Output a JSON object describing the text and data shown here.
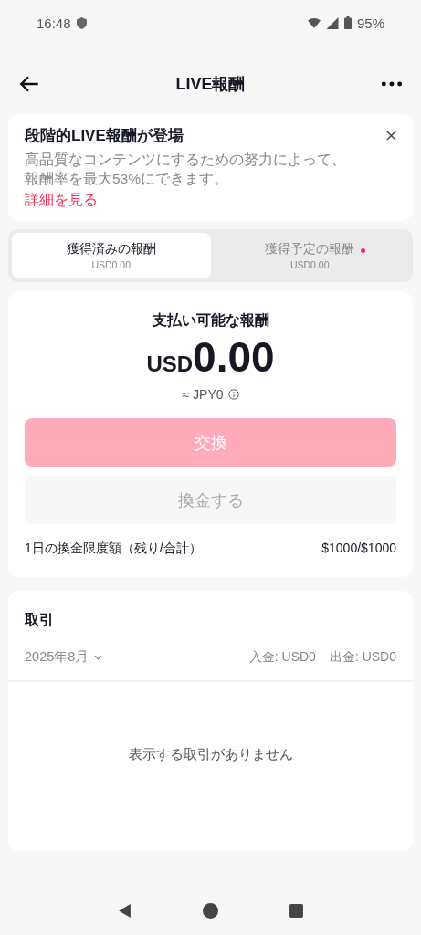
{
  "status_bar": {
    "time": "16:48",
    "battery": "95%"
  },
  "header": {
    "title": "LIVE報酬"
  },
  "banner": {
    "title": "段階的LIVE報酬が登場",
    "body": "高品質なコンテンツにするための努力によって、報酬率を最大53%にできます。",
    "link": "詳細を見る"
  },
  "tabs": [
    {
      "label": "獲得済みの報酬",
      "amount": "USD0.00",
      "selected": true,
      "dot": false
    },
    {
      "label": "獲得予定の報酬",
      "amount": "USD0.00",
      "selected": false,
      "dot": true
    }
  ],
  "balance": {
    "label": "支払い可能な報酬",
    "currency": "USD",
    "amount": "0.00",
    "converted": "≈ JPY0"
  },
  "buttons": [
    {
      "label": "交換",
      "kind": "primary",
      "disabled": true
    },
    {
      "label": "換金する",
      "kind": "secondary",
      "disabled": true
    }
  ],
  "limit": {
    "label": "1日の換金限度額（残り/合計）",
    "value": "$1000/$1000"
  },
  "transactions": {
    "title": "取引",
    "month": "2025年8月",
    "income": "入金: USD0",
    "outgo": "出金: USD0",
    "empty": "表示する取引がありません"
  }
}
